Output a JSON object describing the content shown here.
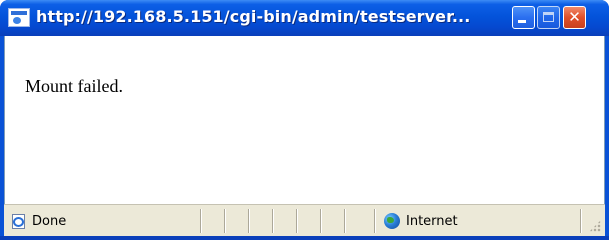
{
  "window": {
    "title": "http://192.168.5.151/cgi-bin/admin/testserver..."
  },
  "content": {
    "message": "Mount failed."
  },
  "statusbar": {
    "status": "Done",
    "zone": "Internet"
  },
  "icons": {
    "title": "ie-page-icon",
    "status": "ie-page-icon",
    "zone": "globe-icon"
  },
  "colors": {
    "titlebar": "#0453da",
    "close_button": "#e0502a",
    "statusbar": "#ece9d8"
  }
}
